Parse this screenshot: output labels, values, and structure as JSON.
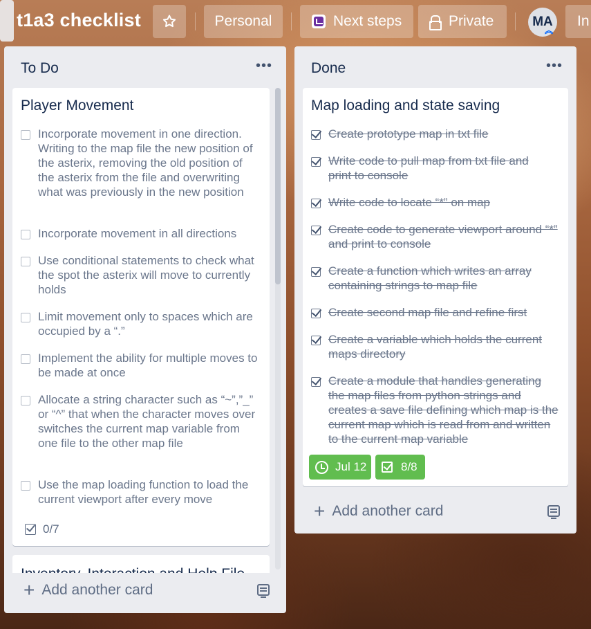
{
  "header": {
    "board_title": "t1a3 checklist",
    "star_icon": "star-icon",
    "personal_label": "Personal",
    "next_steps_label": "Next steps",
    "private_label": "Private",
    "avatar_initials": "MA",
    "overflow_label": "In"
  },
  "lists": [
    {
      "title": "To Do",
      "cards": [
        {
          "title": "Player Movement",
          "items": [
            {
              "text": "Incorporate movement in one direction. Writing to the map file the new position of the asterix, removing the old position of the asterix from the file and overwriting what was previously in the new position",
              "checked": false
            },
            {
              "text": "Incorporate movement in all directions",
              "checked": false
            },
            {
              "text": "Use conditional statements to check what the spot the asterix will move to currently holds",
              "checked": false
            },
            {
              "text": "Limit movement only to spaces which are occupied by a “.”",
              "checked": false
            },
            {
              "text": "Implement the ability for multiple moves to be made at once",
              "checked": false
            },
            {
              "text": "Allocate a string character such as “~”,”_” or “^” that when the character moves over switches the current map variable from one file to the other map file",
              "checked": false
            },
            {
              "text": "Use the map loading function to load the current viewport after every move",
              "checked": false
            }
          ],
          "checklist_progress": "0/7"
        },
        {
          "title": "Inventory, Interaction and Help File"
        }
      ],
      "add_card_label": "Add another card"
    },
    {
      "title": "Done",
      "cards": [
        {
          "title": "Map loading and state saving",
          "items": [
            {
              "text": "Create prototype map in txt file",
              "checked": true
            },
            {
              "text": "Write code to pull map from txt file and print to console",
              "checked": true
            },
            {
              "text": "Write code to locate “*” on map",
              "checked": true
            },
            {
              "text": "Create code to generate viewport around “*” and print to console",
              "checked": true
            },
            {
              "text": "Create a function which writes an array containing strings to map file",
              "checked": true
            },
            {
              "text": "Create second map file and refine first",
              "checked": true
            },
            {
              "text": "Create a variable which holds the current maps directory",
              "checked": true
            },
            {
              "text": "Create a module that handles generating the map files from python strings and creates a save file defining which map is the current map which is read from and written to the current map variable",
              "checked": true
            }
          ],
          "due_date": "Jul 12",
          "checklist_progress": "8/8"
        }
      ],
      "add_card_label": "Add another card"
    }
  ],
  "colors": {
    "list_bg": "#ebecf0",
    "badge_green": "#61bd4f",
    "text_dark": "#172b4d",
    "text_muted": "#6b778c"
  }
}
